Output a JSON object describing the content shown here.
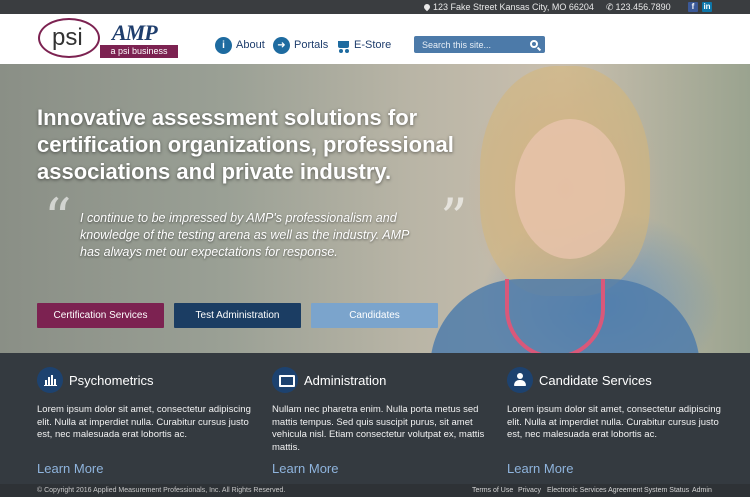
{
  "topbar": {
    "address": "123 Fake Street Kansas City, MO 66204",
    "phone": "123.456.7890",
    "social": [
      "facebook-icon",
      "linkedin-icon"
    ]
  },
  "logo": {
    "psi": "psi",
    "amp": "AMP",
    "tagline": "a psi business"
  },
  "nav": {
    "about": "About",
    "portals": "Portals",
    "estore": "E-Store",
    "search_placeholder": "Search this site..."
  },
  "hero": {
    "headline": "Innovative assessment solutions for certification organizations, professional associations and private industry.",
    "quote": "I continue to be impressed by AMP's professionalism and knowledge of the testing arena as well as the industry. AMP has always met our expectations for response.",
    "buttons": {
      "certification": "Certification Services",
      "test_admin": "Test Administration",
      "candidates": "Candidates"
    }
  },
  "features": [
    {
      "title": "Psychometrics",
      "icon": "bar-chart-icon",
      "text": "Lorem ipsum dolor sit amet, consectetur adipiscing elit. Nulla at imperdiet nulla. Curabitur cursus justo est, nec malesuada erat lobortis ac.",
      "link": "Learn More"
    },
    {
      "title": "Administration",
      "icon": "monitor-icon",
      "text": "Nullam nec pharetra enim. Nulla porta metus sed mattis tempus. Sed quis suscipit purus, sit amet vehicula nisl. Etiam consectetur volutpat ex, mattis mattis.",
      "link": "Learn More"
    },
    {
      "title": "Candidate Services",
      "icon": "user-icon",
      "text": "Lorem ipsum dolor sit amet, consectetur adipiscing elit. Nulla at imperdiet nulla. Curabitur cursus justo est, nec malesuada erat lobortis ac.",
      "link": "Learn More"
    }
  ],
  "footer": {
    "copyright": "© Copyright 2016 Applied Measurement Professionals, Inc. All Rights Reserved.",
    "links": [
      "Terms of Use",
      "Privacy",
      "Electronic Services Agreement",
      "System Status",
      "Admin"
    ]
  },
  "colors": {
    "brand_maroon": "#7c2251",
    "brand_navy": "#1b3d63",
    "brand_light_blue": "#7ba4cc",
    "link_blue": "#8fb4dd"
  }
}
